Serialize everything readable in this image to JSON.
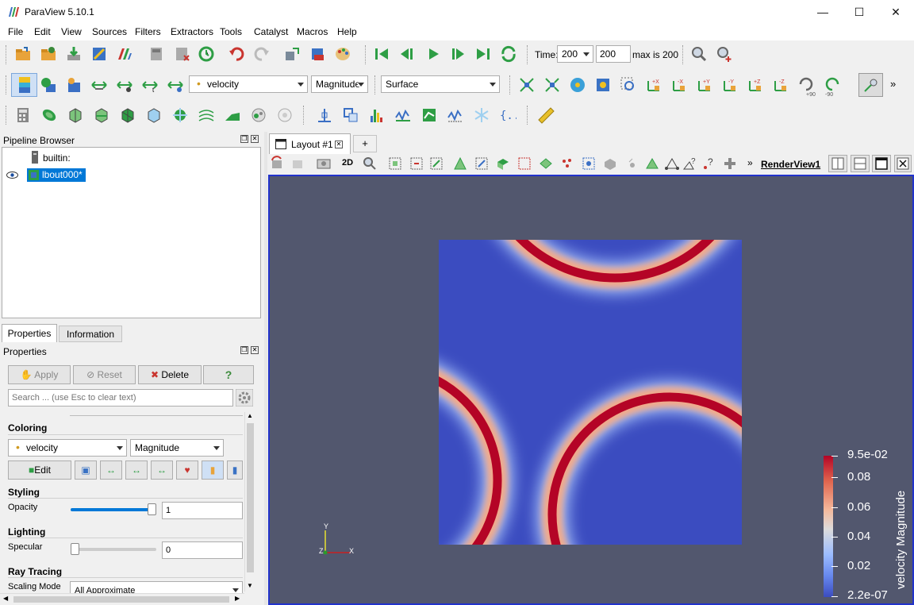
{
  "app": {
    "title": "ParaView 5.10.1"
  },
  "window_controls": {
    "minimize": "—",
    "maximize": "☐",
    "close": "✕"
  },
  "menus": [
    "File",
    "Edit",
    "View",
    "Sources",
    "Filters",
    "Extractors",
    "Tools",
    "Catalyst",
    "Macros",
    "Help"
  ],
  "time": {
    "label": "Time:",
    "value": "200",
    "index": "200",
    "max_label": "max is 200"
  },
  "coloring_toolbar": {
    "array": "velocity",
    "component": "Magnitude",
    "representation": "Surface"
  },
  "pipeline": {
    "title": "Pipeline Browser",
    "items": [
      {
        "label": "builtin:"
      },
      {
        "label": "lbout000*"
      }
    ]
  },
  "tabs": {
    "properties": "Properties",
    "information": "Information"
  },
  "properties": {
    "title": "Properties",
    "apply": "Apply",
    "reset": "Reset",
    "delete": "Delete",
    "help": "?",
    "search_placeholder": "Search ... (use Esc to clear text)",
    "coloring": "Coloring",
    "color_array": "velocity",
    "color_component": "Magnitude",
    "edit": "Edit",
    "styling": "Styling",
    "opacity_label": "Opacity",
    "opacity_value": "1",
    "opacity_fraction": 1.0,
    "lighting": "Lighting",
    "specular_label": "Specular",
    "specular_value": "0",
    "specular_fraction": 0.0,
    "ray_tracing": "Ray Tracing",
    "scaling_mode_label": "Scaling Mode",
    "scaling_mode_value": "All Approximate"
  },
  "layout_tab": {
    "label": "Layout #1",
    "add": "+"
  },
  "render_view": {
    "label": "RenderView1",
    "mode_2d": "2D"
  },
  "colorbar": {
    "title": "velocity Magnitude",
    "ticks": [
      "9.5e-02",
      "0.08",
      "0.06",
      "0.04",
      "0.02",
      "2.2e-07"
    ]
  },
  "axes": {
    "y": "Y",
    "z": "Z",
    "x": "X"
  },
  "colors": {
    "background": "#52576e",
    "low": "#3b4cc0",
    "high": "#b40426",
    "accent": "#2233cc"
  }
}
